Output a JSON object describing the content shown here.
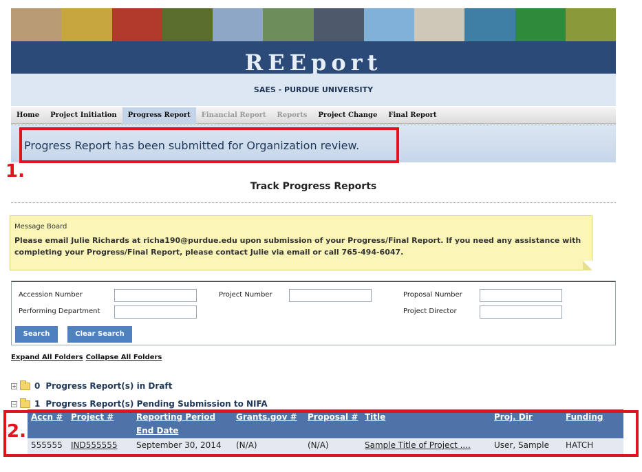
{
  "header": {
    "brand": "REEport",
    "organization": "SAES - PURDUE UNIVERSITY"
  },
  "nav": {
    "items": [
      {
        "label": "Home",
        "state": "normal"
      },
      {
        "label": "Project Initiation",
        "state": "normal"
      },
      {
        "label": "Progress Report",
        "state": "active"
      },
      {
        "label": "Financial Report",
        "state": "disabled"
      },
      {
        "label": "Reports",
        "state": "disabled"
      },
      {
        "label": "Project Change",
        "state": "normal"
      },
      {
        "label": "Final Report",
        "state": "normal"
      }
    ]
  },
  "alert": {
    "message": "Progress Report has been submitted for Organization review."
  },
  "annotations": {
    "one": "1.",
    "two": "2."
  },
  "page_title": "Track Progress Reports",
  "message_board": {
    "title": "Message Board",
    "body": "Please email Julie Richards at richa190@purdue.edu upon submission of your Progress/Final Report. If you need any assistance with completing your Progress/Final Report, please contact Julie via email or call 765-494-6047."
  },
  "search": {
    "accession_label": "Accession Number",
    "performing_dept_label": "Performing Department",
    "project_number_label": "Project Number",
    "proposal_number_label": "Proposal Number",
    "project_director_label": "Project Director",
    "search_button": "Search",
    "clear_button": "Clear Search"
  },
  "folders": {
    "expand_all": "Expand All Folders",
    "collapse_all": "Collapse All Folders",
    "draft": {
      "expander": "+",
      "count": "0",
      "label": "Progress Report(s) in Draft"
    },
    "pending": {
      "expander": "−",
      "count": "1",
      "label": "Progress Report(s) Pending Submission to NIFA"
    }
  },
  "table": {
    "headers": {
      "accn": "Accn #",
      "project": "Project #",
      "period_line1": "Reporting Period",
      "period_line2": "End Date",
      "grants": "Grants.gov #",
      "proposal": "Proposal #",
      "title": "Title",
      "proj_dir": "Proj. Dir",
      "funding": "Funding"
    },
    "rows": [
      {
        "accn": "555555",
        "project": "IND555555",
        "period_end": "September 30, 2014",
        "grants": "(N/A)",
        "proposal": "(N/A)",
        "title": "Sample Title of Project ....",
        "proj_dir": "User, Sample",
        "funding": "HATCH"
      }
    ]
  },
  "colors": {
    "banner": "#2b4a78",
    "annotation_red": "#e0141c",
    "table_header": "#4e73a8",
    "button": "#4f80c0",
    "message_board": "#fbf6b8"
  }
}
